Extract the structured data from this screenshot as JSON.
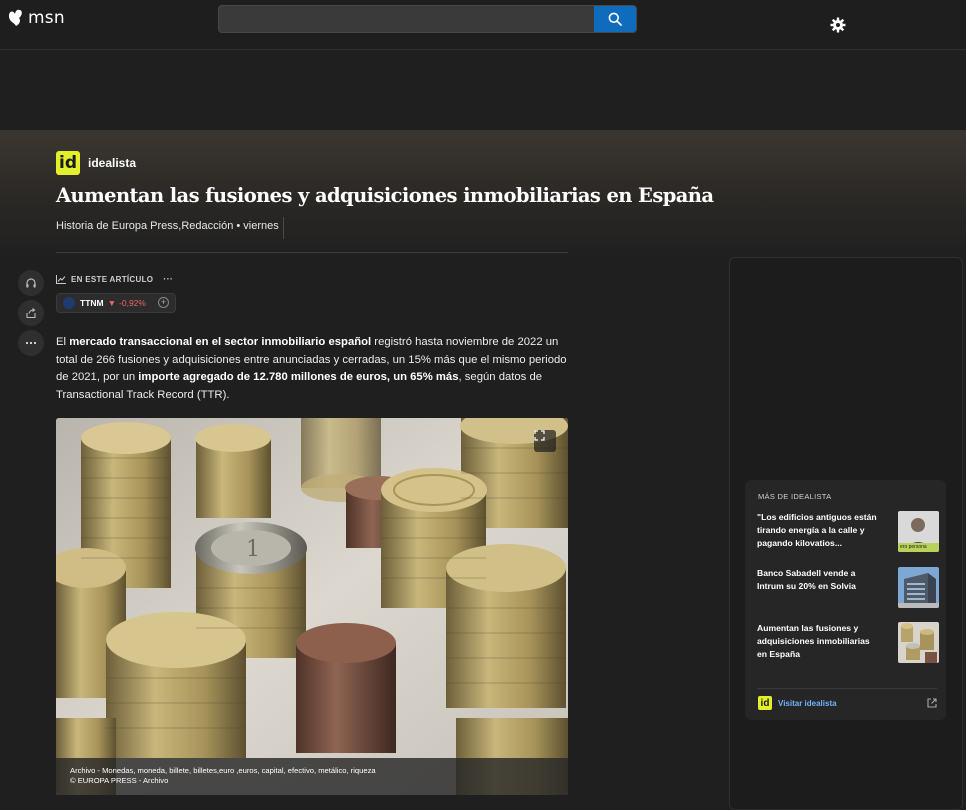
{
  "header": {
    "logo_text": "msn",
    "search": {
      "value": "",
      "placeholder": ""
    },
    "search_icon": "search-icon",
    "settings_icon": "gear-icon"
  },
  "article": {
    "publisher": "idealista",
    "publisher_logo": "id",
    "title": "Aumentan las fusiones y adquisiciones inmobiliarias en España",
    "byline": "Historia de Europa Press,Redacción • viernes",
    "in_article_label": "EN ESTE ARTÍCULO",
    "in_article_more": "···",
    "stock": {
      "symbol": "TTNM",
      "arrow": "▼",
      "change": "-0,92%",
      "color": "#f06464"
    },
    "body": [
      {
        "text": "El ",
        "bold": false
      },
      {
        "text": "mercado transaccional en el sector inmobiliario español",
        "bold": true
      },
      {
        "text": " registró hasta noviembre de 2022 un total de 266 fusiones y adquisiciones entre anunciadas y cerradas, un 15% más que el mismo periodo de 2021, por un ",
        "bold": false
      },
      {
        "text": "importe agregado de 12.780 millones de euros, un 65% más",
        "bold": true
      },
      {
        "text": ", según datos de Transactional Track Record (TTR).",
        "bold": false
      }
    ],
    "image": {
      "caption_line1": "Archivo - Monedas, moneda, billete, billetes,euro ,euros, capital, efectivo, metálico, riqueza",
      "caption_line2": "© EUROPA PRESS - Archivo"
    },
    "side_actions": [
      "headphones-icon",
      "share-icon",
      "more-icon"
    ]
  },
  "sidebar": {
    "more_heading": "MÁS DE IDEALISTA",
    "items": [
      {
        "title": "\"Los edificios antiguos están tirando energía a la calle y pagando kilovatios..."
      },
      {
        "title": "Banco Sabadell vende a Intrum su 20% en Solvia"
      },
      {
        "title": "Aumentan las fusiones y adquisiciones inmobiliarias en España"
      }
    ],
    "thumb1_caption": "ero persona",
    "visit_label": "Visitar idealista"
  },
  "colors": {
    "accent": "#0f6cbd",
    "brand_yellow": "#e3ef2b",
    "link": "#6eb4ff"
  }
}
